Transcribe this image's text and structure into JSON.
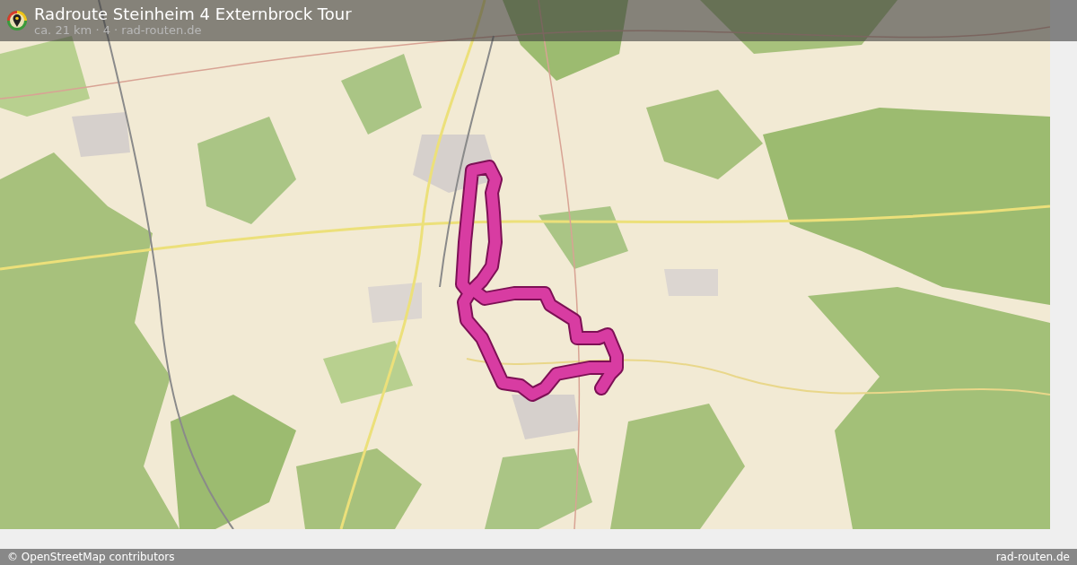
{
  "header": {
    "title": "Radroute Steinheim 4 Externbrock Tour",
    "subtitle": "ca. 21 km · 4 · rad-routen.de"
  },
  "footer": {
    "attribution": "© OpenStreetMap contributors",
    "site": "rad-routen.de"
  }
}
